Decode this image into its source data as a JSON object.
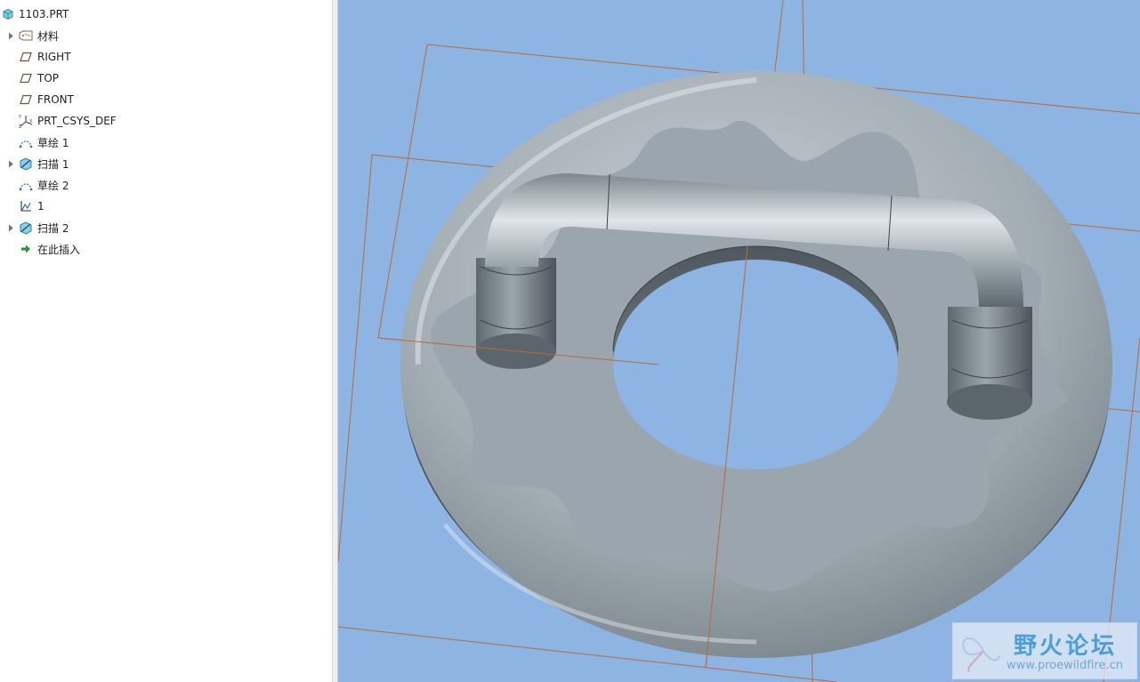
{
  "tree": {
    "root": "1103.PRT",
    "items": [
      {
        "label": "材料",
        "icon": "material-tag-icon",
        "expandable": true
      },
      {
        "label": "RIGHT",
        "icon": "datum-plane-icon",
        "expandable": false
      },
      {
        "label": "TOP",
        "icon": "datum-plane-icon",
        "expandable": false
      },
      {
        "label": "FRONT",
        "icon": "datum-plane-icon",
        "expandable": false
      },
      {
        "label": "PRT_CSYS_DEF",
        "icon": "coordinate-system-icon",
        "expandable": false
      },
      {
        "label": "草绘 1",
        "icon": "sketch-icon",
        "expandable": false
      },
      {
        "label": "扫描 1",
        "icon": "sweep-feature-icon",
        "expandable": true
      },
      {
        "label": "草绘 2",
        "icon": "sketch-icon",
        "expandable": false
      },
      {
        "label": "1",
        "icon": "graph-feature-icon",
        "expandable": false
      },
      {
        "label": "扫描 2",
        "icon": "sweep-feature-icon",
        "expandable": true
      },
      {
        "label": "在此插入",
        "icon": "insert-here-arrow-icon",
        "expandable": false
      }
    ]
  },
  "watermark": {
    "title": "野火论坛",
    "url": "www.proewildfire.cn"
  },
  "colors": {
    "viewport_bg": "#8db4e2",
    "model": "#9aa6ae",
    "datum_line": "#b96a3a"
  }
}
